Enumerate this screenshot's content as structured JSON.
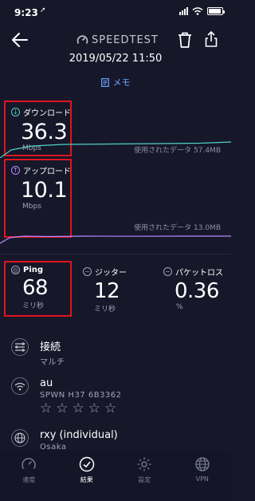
{
  "status_bar": {
    "time": "9:23",
    "location_icon": "location-arrow-icon",
    "signal_icon": "cellular-signal-icon",
    "wifi_icon": "wifi-icon",
    "battery_icon": "battery-icon"
  },
  "header": {
    "logo_text": "SPEEDTEST",
    "back_icon": "back-arrow-icon",
    "trash_icon": "trash-icon",
    "share_icon": "share-icon"
  },
  "date": "2019/05/22 11:50",
  "memo": {
    "label": "メモ",
    "icon": "note-icon"
  },
  "download": {
    "label": "ダウンロード",
    "value": "36.3",
    "unit": "Mbps",
    "usage": "使用されたデータ 57.4MB",
    "color": "#4fd1c5"
  },
  "upload": {
    "label": "アップロード",
    "value": "10.1",
    "unit": "Mbps",
    "usage": "使用されたデータ 13.0MB",
    "color": "#b58aff"
  },
  "ping": {
    "label": "Ping",
    "value": "68",
    "unit": "ミリ秒"
  },
  "jitter": {
    "label": "ジッター",
    "value": "12",
    "unit": "ミリ秒"
  },
  "packet_loss": {
    "label": "パケットロス",
    "value": "0.36",
    "unit": "%"
  },
  "connection": {
    "title": "接続",
    "value": "マルチ",
    "icon": "connections-icon"
  },
  "provider": {
    "title": "au",
    "detail": "SPWN H37 6B3362",
    "icon": "wifi-icon",
    "rating": 0,
    "stars": [
      "☆",
      "☆",
      "☆",
      "☆",
      "☆"
    ]
  },
  "server": {
    "title": "rxy (individual)",
    "location": "Osaka",
    "icon": "globe-icon"
  },
  "nav": [
    {
      "label": "速度",
      "icon": "speedometer-icon",
      "active": false
    },
    {
      "label": "結果",
      "icon": "check-circle-icon",
      "active": true
    },
    {
      "label": "設定",
      "icon": "settings-gear-icon",
      "active": false
    },
    {
      "label": "VPN",
      "icon": "vpn-globe-icon",
      "active": false
    }
  ],
  "colors": {
    "background": "#17172a",
    "highlight_box": "#e0141e",
    "memo_accent": "#6ba7ff"
  }
}
